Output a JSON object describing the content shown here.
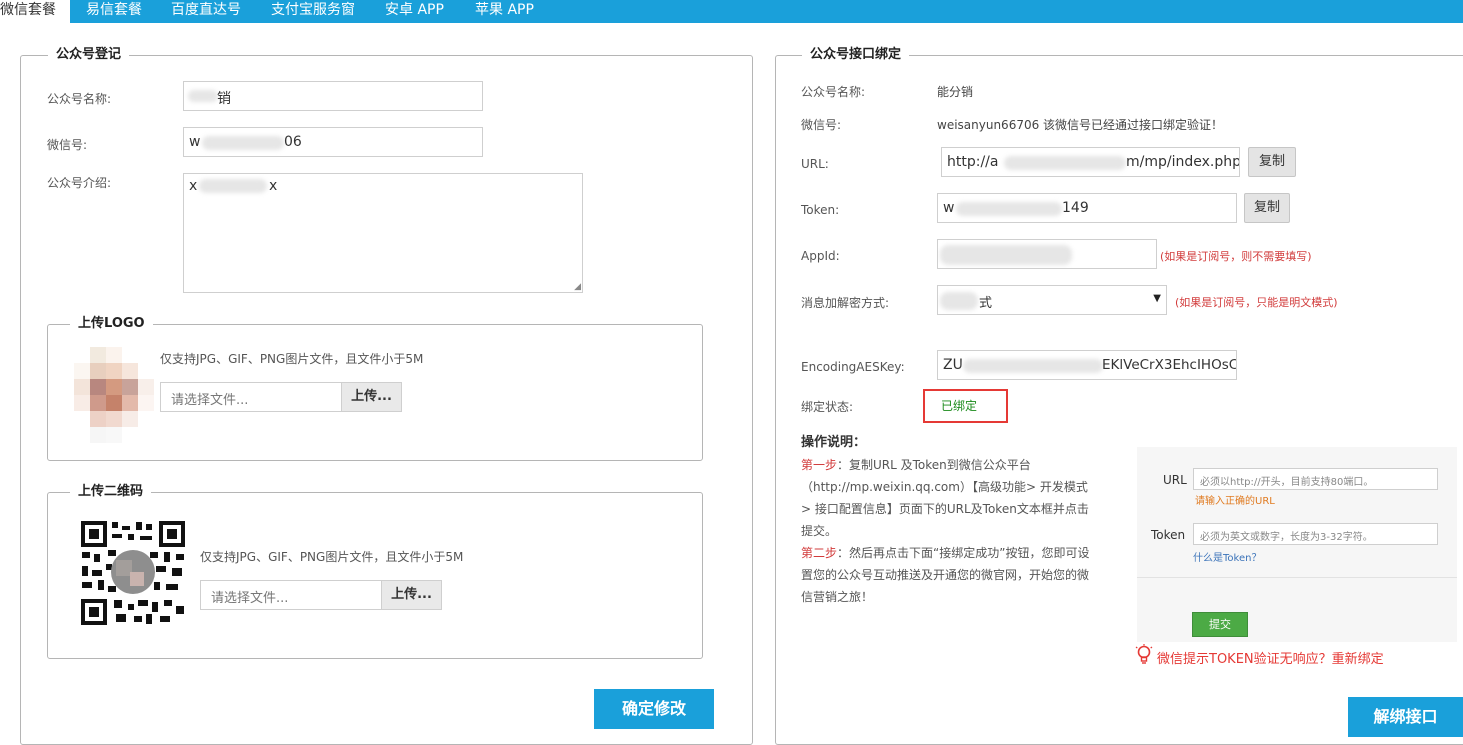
{
  "tabs": [
    "微信套餐",
    "易信套餐",
    "百度直达号",
    "支付宝服务窗",
    "安卓 APP",
    "苹果 APP"
  ],
  "left": {
    "legend": "公众号登记",
    "name_label": "公众号名称:",
    "name_value": "销",
    "wechat_label": "微信号:",
    "wechat_value_start": "w",
    "wechat_value_end": "06",
    "intro_label": "公众号介绍:",
    "intro_value_start": "x",
    "intro_value_end": "x",
    "logo": {
      "legend": "上传LOGO",
      "hint": "仅支持JPG、GIF、PNG图片文件，且文件小于5M",
      "placeholder": "请选择文件...",
      "upload_label": "上传..."
    },
    "qr": {
      "legend": "上传二维码",
      "hint": "仅支持JPG、GIF、PNG图片文件，且文件小于5M",
      "placeholder": "请选择文件...",
      "upload_label": "上传..."
    },
    "submit_label": "确定修改"
  },
  "right": {
    "legend": "公众号接口绑定",
    "name_label": "公众号名称:",
    "name_value": "能分销",
    "wechat_label": "微信号:",
    "wechat_value": "weisanyun66706 该微信号已经通过接口绑定验证！",
    "url_label": "URL:",
    "url_value_start": "http://a",
    "url_value_end": "m/mp/index.php",
    "copy_label": "复制",
    "token_label": "Token:",
    "token_value_start": "w",
    "token_value_end": "149",
    "appid_label": "AppId:",
    "appid_hint": "(如果是订阅号，则不需要填写)",
    "encrypt_label": "消息加解密方式:",
    "encrypt_value": "式",
    "encrypt_hint": "(如果是订阅号，只能是明文模式)",
    "aes_label": "EncodingAESKey:",
    "aes_value_start": "ZU",
    "aes_value_end": "EKlVeCrX3EhcIHOsC",
    "status_label": "绑定状态:",
    "status_value": "已绑定",
    "instr_title": "操作说明：",
    "step1_label": "第一步",
    "step1_text": "：复制URL 及Token到微信公众平台（http://mp.weixin.qq.com）【高级功能> 开发模式 > 接口配置信息】页面下的URL及Token文本框并点击提交。",
    "step2_label": "第二步",
    "step2_text": "：然后再点击下面“接绑定成功”按钮，您即可设置您的公众号互动推送及开通您的微官网，开始您的微信营销之旅！",
    "example": {
      "url_label": "URL",
      "url_placeholder": "必须以http://开头，目前支持80端口。",
      "url_error": "请输入正确的URL",
      "token_label": "Token",
      "token_placeholder": "必须为英文或数字，长度为3-32字符。",
      "token_link": "什么是Token？",
      "submit_label": "提交"
    },
    "rebind_text": "微信提示TOKEN验证无响应？重新绑定",
    "unbind_label": "解绑接口"
  },
  "colors": {
    "accent": "#1aa0da",
    "status_green": "#1a8a1a",
    "hint_red": "#d23c3c",
    "highlight_box": "#e53935",
    "example_submit": "#4caa45"
  }
}
